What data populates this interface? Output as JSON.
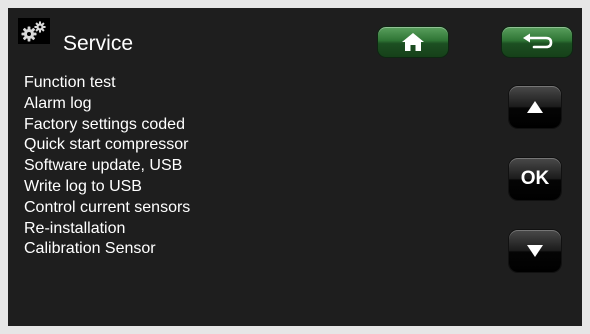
{
  "header": {
    "title": "Service",
    "title_icon": "gears-icon",
    "home_icon": "home-icon",
    "back_icon": "back-arrow-icon"
  },
  "menu": {
    "items": [
      {
        "label": "Function test"
      },
      {
        "label": "Alarm log"
      },
      {
        "label": "Factory settings coded"
      },
      {
        "label": "Quick start compressor"
      },
      {
        "label": "Software update, USB"
      },
      {
        "label": "Write log to USB"
      },
      {
        "label": "Control current sensors"
      },
      {
        "label": "Re-installation"
      },
      {
        "label": "Calibration Sensor"
      }
    ]
  },
  "nav": {
    "up_icon": "triangle-up-icon",
    "ok_label": "OK",
    "down_icon": "triangle-down-icon"
  },
  "colors": {
    "background": "#1e1e1e",
    "text": "#ffffff",
    "header_button": "#2f7535",
    "side_button": "#1a1a1a"
  }
}
